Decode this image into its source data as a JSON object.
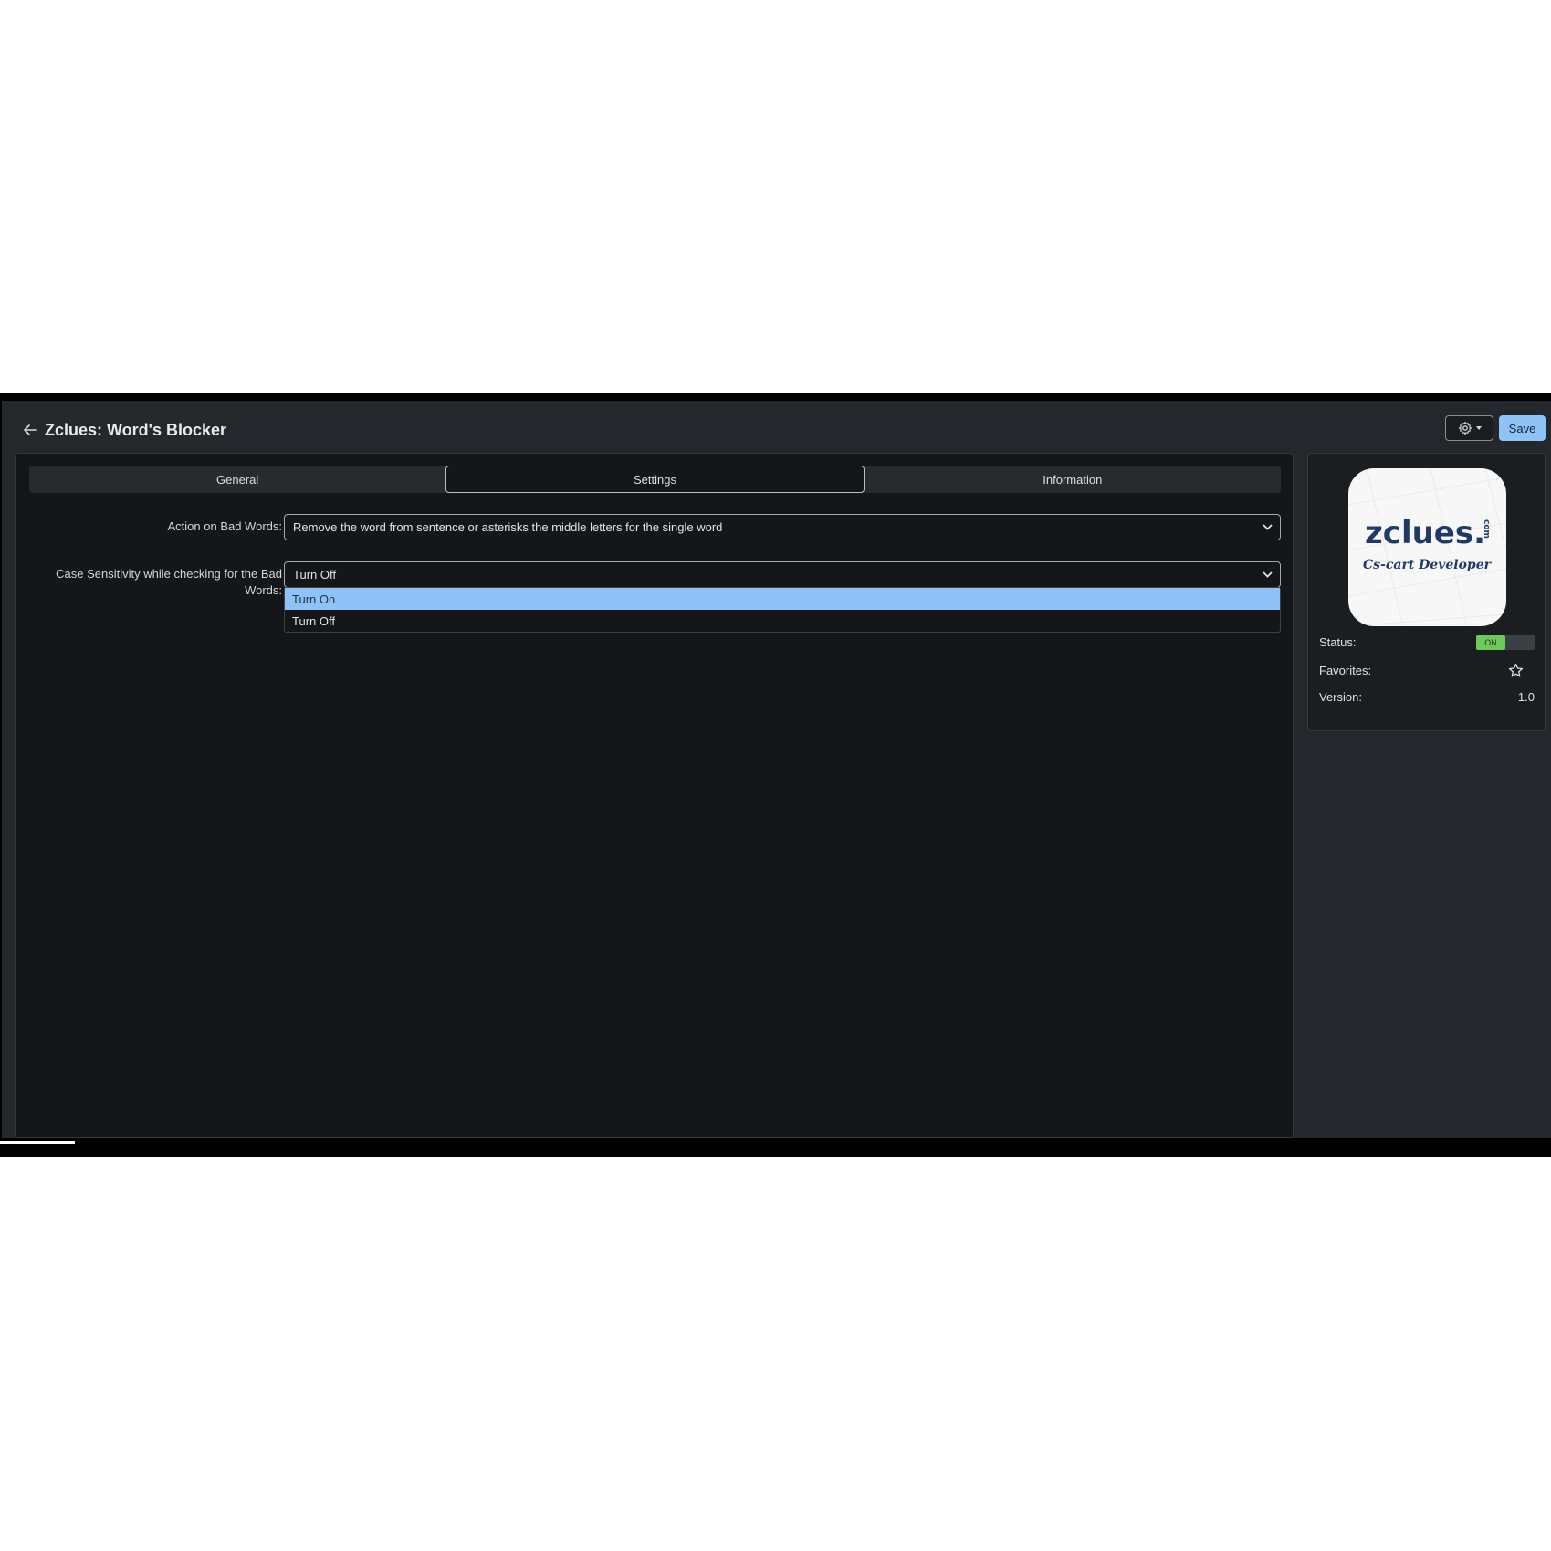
{
  "header": {
    "title": "Zclues: Word's Blocker",
    "save_label": "Save"
  },
  "tabs": [
    {
      "label": "General",
      "active": false
    },
    {
      "label": "Settings",
      "active": true
    },
    {
      "label": "Information",
      "active": false
    }
  ],
  "settings": {
    "action_label": "Action on Bad Words:",
    "action_value": "Remove the word from sentence or asterisks the middle letters for the single word",
    "case_label": "Case Sensitivity while checking for the Bad Words:",
    "case_value": "Turn Off",
    "case_options": [
      "Turn On",
      "Turn Off"
    ]
  },
  "sidebar": {
    "logo_text": "zclues.",
    "logo_suffix": "com",
    "logo_tagline": "Cs-cart Developer",
    "status_label": "Status:",
    "status_value": "ON",
    "favorites_label": "Favorites:",
    "version_label": "Version:",
    "version_value": "1.0"
  },
  "colors": {
    "accent": "#8fc3f7",
    "status_on": "#6fc95a",
    "logo_blue": "#1f3a66"
  }
}
